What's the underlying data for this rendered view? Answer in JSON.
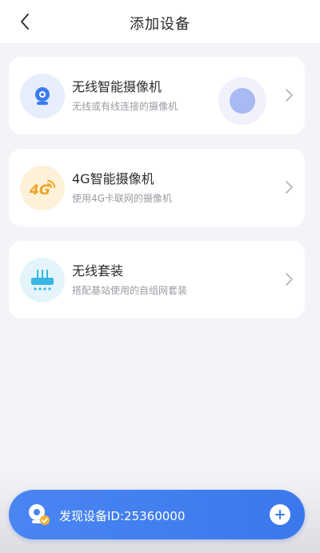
{
  "header": {
    "title": "添加设备",
    "back_icon": "chevron-left-icon"
  },
  "cards": [
    {
      "title": "无线智能摄像机",
      "subtitle": "无线或有线连接的摄像机",
      "icon": "webcam-icon",
      "icon_bg": "#e6eefc",
      "icon_color": "#3d7bf0"
    },
    {
      "title": "4G智能摄像机",
      "subtitle": "使用4G卡联网的摄像机",
      "icon": "4g-icon",
      "icon_bg": "#fdf1da",
      "icon_color": "#f0a324"
    },
    {
      "title": "无线套装",
      "subtitle": "搭配基站使用的自组网套装",
      "icon": "router-icon",
      "icon_bg": "#e3f5fb",
      "icon_color": "#38b6e6"
    }
  ],
  "discover": {
    "label": "发现设备ID:25360000",
    "icon": "camera-found-icon",
    "action_icon": "plus-icon"
  },
  "colors": {
    "accent": "#3d7bf0",
    "background": "#f4f3f8"
  }
}
